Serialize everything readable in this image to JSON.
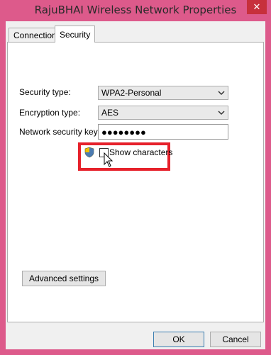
{
  "window": {
    "title": "RajuBHAI Wireless Network Properties",
    "close_glyph": "✕"
  },
  "tabs": [
    {
      "label": "Connection",
      "active": false
    },
    {
      "label": "Security",
      "active": true
    }
  ],
  "security": {
    "security_type_label": "Security type:",
    "security_type_value": "WPA2-Personal",
    "encryption_type_label": "Encryption type:",
    "encryption_type_value": "AES",
    "network_key_label": "Network security key",
    "network_key_value": "●●●●●●●●",
    "show_characters_label": "Show characters",
    "show_characters_checked": false
  },
  "buttons": {
    "advanced": "Advanced settings",
    "ok": "OK",
    "cancel": "Cancel"
  },
  "colors": {
    "accent_frame": "#dd5a8b",
    "close_button": "#c7303c",
    "highlight_box": "#e6212b"
  },
  "icons": {
    "uac_shield": "shield-icon",
    "dropdown": "chevron-down-icon",
    "pointer": "mouse-cursor-icon"
  }
}
